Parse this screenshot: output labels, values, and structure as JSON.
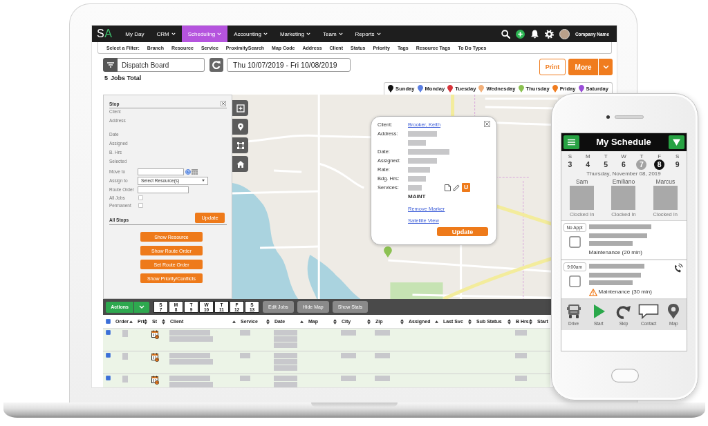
{
  "nav": {
    "logo": "SA",
    "items": [
      {
        "label": "My Day",
        "dropdown": false,
        "selected": false
      },
      {
        "label": "CRM",
        "dropdown": true,
        "selected": false
      },
      {
        "label": "Scheduling",
        "dropdown": true,
        "selected": true
      },
      {
        "label": "Accounting",
        "dropdown": true,
        "selected": false
      },
      {
        "label": "Marketing",
        "dropdown": true,
        "selected": false
      },
      {
        "label": "Team",
        "dropdown": true,
        "selected": false
      },
      {
        "label": "Reports",
        "dropdown": true,
        "selected": false
      }
    ],
    "account": "Company Name"
  },
  "filter_bar": {
    "label": "Select a Filter:",
    "filters": [
      "Branch",
      "Resource",
      "Service",
      "ProximitySearch",
      "Map Code",
      "Address",
      "Client",
      "Status",
      "Priority",
      "Tags",
      "Resource Tags",
      "To Do Types"
    ]
  },
  "toolbar": {
    "view": "Dispatch Board",
    "date_range": "Thu 10/07/2019 - Fri 10/08/2019",
    "print": "Print",
    "more": "More"
  },
  "summary": {
    "count": "5",
    "label": "Jobs Total"
  },
  "legend": [
    {
      "label": "Sunday",
      "color": "#111111"
    },
    {
      "label": "Monday",
      "color": "#5b7fe3"
    },
    {
      "label": "Tuesday",
      "color": "#d8343b"
    },
    {
      "label": "Wednesday",
      "color": "#f2b07a"
    },
    {
      "label": "Thursday",
      "color": "#8cc152"
    },
    {
      "label": "Friday",
      "color": "#f07c1e"
    },
    {
      "label": "Saturday",
      "color": "#9b4fd9"
    }
  ],
  "stop_panel": {
    "title": "Stop",
    "info": [
      {
        "label": "Client",
        "multiline": false
      },
      {
        "label": "Address",
        "multiline": true
      },
      {
        "label": "Date",
        "multiline": false
      },
      {
        "label": "Assigned",
        "multiline": false
      },
      {
        "label": "B. Hrs",
        "multiline": false
      },
      {
        "label": "Selected",
        "multiline": false
      }
    ],
    "move_to": {
      "label": "Move to"
    },
    "assign_to": {
      "label": "Assign to",
      "value": "Select Resource(s)"
    },
    "route_order": {
      "label": "Route Order"
    },
    "options": [
      {
        "label": "All Jobs",
        "checked": false
      },
      {
        "label": "Permanent",
        "checked": false
      }
    ],
    "update": "Update",
    "all_stops": "All Stops",
    "actions": [
      "Show Resource",
      "Show Route Order",
      "Set Route Order",
      "Show Priority/Conflicts"
    ]
  },
  "map": {
    "markers": [
      {
        "color": "#8cc152"
      }
    ],
    "popup": {
      "fields": [
        {
          "label": "Client:",
          "link": "Brooker, Keith"
        },
        {
          "label": "Address:"
        },
        {
          "label": "Date:"
        },
        {
          "label": "Assigned:"
        },
        {
          "label": "Rate:"
        },
        {
          "label": "Bdg. Hrs:"
        },
        {
          "label": "Services:",
          "badge": "U"
        }
      ],
      "service_code": "MAINT",
      "links": [
        "Remove Marker",
        "Satellite View"
      ],
      "update": "Update"
    }
  },
  "bottom_bar": {
    "actions": "Actions",
    "days": [
      {
        "weekday": "S",
        "date": "7"
      },
      {
        "weekday": "M",
        "date": "8"
      },
      {
        "weekday": "T",
        "date": "9"
      },
      {
        "weekday": "W",
        "date": "10"
      },
      {
        "weekday": "T",
        "date": "11"
      },
      {
        "weekday": "F",
        "date": "12"
      },
      {
        "weekday": "S",
        "date": "13"
      }
    ],
    "buttons": [
      "Edit Jobs",
      "Hide Map",
      "Show Stats"
    ]
  },
  "table": {
    "all_selected": true,
    "columns": [
      {
        "label": "Order",
        "kind": "sorted"
      },
      {
        "label": "Pri",
        "kind": "sortable"
      },
      {
        "label": "St",
        "kind": "sortable"
      },
      {
        "label": "Client",
        "kind": "sorted"
      },
      {
        "label": "Service",
        "kind": "sortable"
      },
      {
        "label": "Date",
        "kind": "sorted"
      },
      {
        "label": "Map",
        "kind": "sortable"
      },
      {
        "label": "City",
        "kind": "sortable"
      },
      {
        "label": "Zip",
        "kind": "sortable"
      },
      {
        "label": "Assigned",
        "kind": "sorted"
      },
      {
        "label": "Last Svc",
        "kind": "sortable"
      },
      {
        "label": "Sub Status",
        "kind": "sortable"
      },
      {
        "label": "B Hrs",
        "kind": "sortable"
      },
      {
        "label": "Start",
        "kind": "plain"
      }
    ],
    "rows": [
      {
        "selected": true
      },
      {
        "selected": true
      },
      {
        "selected": true
      }
    ]
  },
  "phone": {
    "title": "My Schedule",
    "week": [
      {
        "weekday": "S",
        "date": "3",
        "today": false,
        "selected": false
      },
      {
        "weekday": "M",
        "date": "4",
        "today": false,
        "selected": false
      },
      {
        "weekday": "T",
        "date": "5",
        "today": false,
        "selected": false
      },
      {
        "weekday": "W",
        "date": "6",
        "today": false,
        "selected": false
      },
      {
        "weekday": "T",
        "date": "7",
        "today": true,
        "selected": false
      },
      {
        "weekday": "F",
        "date": "8",
        "today": false,
        "selected": true
      },
      {
        "weekday": "S",
        "date": "9",
        "today": false,
        "selected": false
      }
    ],
    "date_heading": "Thursday, November 08, 2019",
    "staff": [
      {
        "name": "Sam",
        "status": "Clocked In"
      },
      {
        "name": "Emiliano",
        "status": "Clocked In"
      },
      {
        "name": "Marcus",
        "status": "Clocked In"
      }
    ],
    "jobs": [
      {
        "time": "No Appt",
        "service": "Maintenance (20 min)",
        "checked": false,
        "call": false,
        "warning": false
      },
      {
        "time": "9:00am",
        "service": "Maintenance (30 min)",
        "checked": false,
        "call": true,
        "warning": true
      }
    ],
    "actions": [
      {
        "label": "Drive",
        "kind": "drive"
      },
      {
        "label": "Start",
        "kind": "start"
      },
      {
        "label": "Skip",
        "kind": "skip"
      },
      {
        "label": "Contact",
        "kind": "contact"
      },
      {
        "label": "Map",
        "kind": "map"
      }
    ]
  }
}
